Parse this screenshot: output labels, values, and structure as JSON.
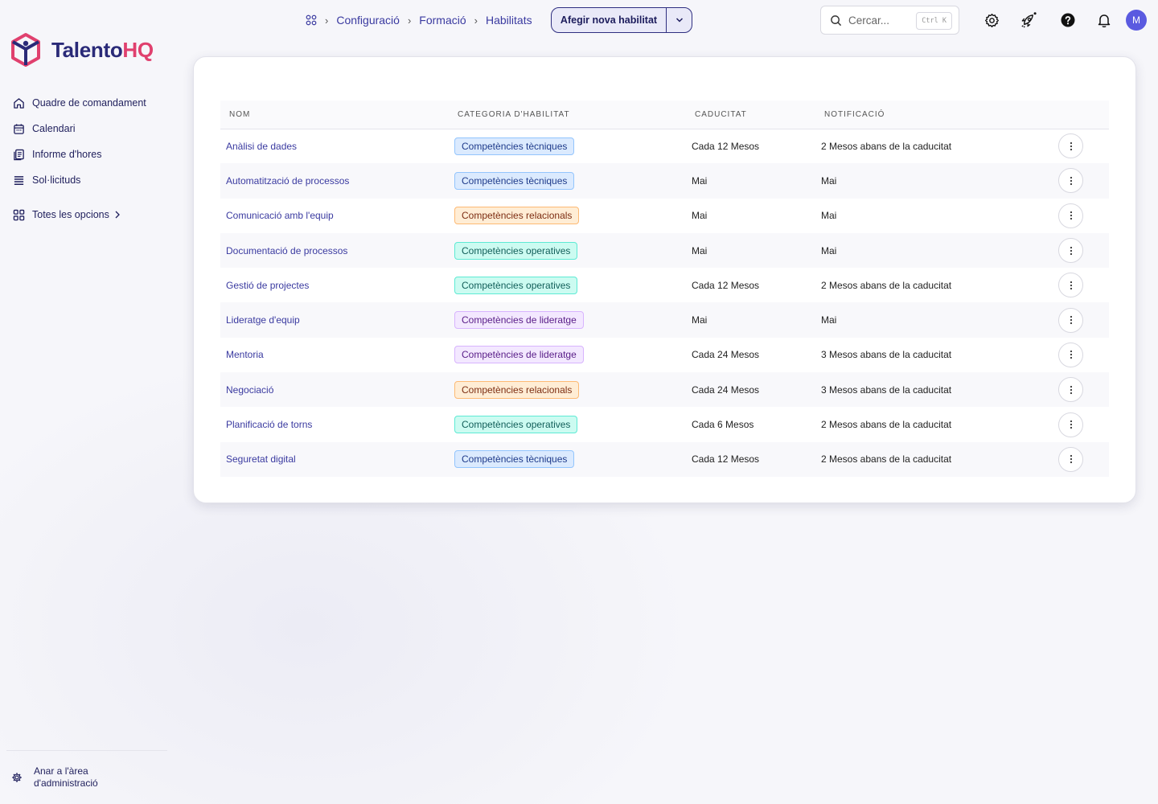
{
  "brand": {
    "name_part1": "Talento",
    "name_part2": "HQ",
    "color_primary": "#2a2a78",
    "color_accent": "#e0406e"
  },
  "sidebar": {
    "items": [
      {
        "label": "Quadre de comandament",
        "icon": "home-icon"
      },
      {
        "label": "Calendari",
        "icon": "calendar-icon"
      },
      {
        "label": "Informe d'hores",
        "icon": "report-icon"
      },
      {
        "label": "Sol·licituds",
        "icon": "list-icon"
      }
    ],
    "all_options": {
      "label": "Totes les opcions",
      "icon": "grid-icon"
    },
    "admin": {
      "line1": "Anar a l'àrea",
      "line2": "d'administració",
      "icon": "gear-icon"
    }
  },
  "topbar": {
    "breadcrumb": [
      "Configuració",
      "Formació",
      "Habilitats"
    ],
    "add_button": "Afegir nova habilitat",
    "search_placeholder": "Cercar...",
    "search_shortcut": "Ctrl K",
    "avatar_initial": "M"
  },
  "table": {
    "columns": [
      "NOM",
      "CATEGORIA D'HABILITAT",
      "CADUCITAT",
      "NOTIFICACIÓ"
    ],
    "rows": [
      {
        "name": "Anàlisi de dades",
        "category": "Competències tècniques",
        "cat": "tec",
        "expiry": "Cada 12 Mesos",
        "notice": "2 Mesos abans de la caducitat"
      },
      {
        "name": "Automatització de processos",
        "category": "Competències tècniques",
        "cat": "tec",
        "expiry": "Mai",
        "notice": "Mai"
      },
      {
        "name": "Comunicació amb l'equip",
        "category": "Competències relacionals",
        "cat": "rel",
        "expiry": "Mai",
        "notice": "Mai"
      },
      {
        "name": "Documentació de processos",
        "category": "Competències operatives",
        "cat": "ope",
        "expiry": "Mai",
        "notice": "Mai"
      },
      {
        "name": "Gestió de projectes",
        "category": "Competències operatives",
        "cat": "ope",
        "expiry": "Cada 12 Mesos",
        "notice": "2 Mesos abans de la caducitat"
      },
      {
        "name": "Lideratge d'equip",
        "category": "Competències de lideratge",
        "cat": "lid",
        "expiry": "Mai",
        "notice": "Mai"
      },
      {
        "name": "Mentoria",
        "category": "Competències de lideratge",
        "cat": "lid",
        "expiry": "Cada 24 Mesos",
        "notice": "3 Mesos abans de la caducitat"
      },
      {
        "name": "Negociació",
        "category": "Competències relacionals",
        "cat": "rel",
        "expiry": "Cada 24 Mesos",
        "notice": "3 Mesos abans de la caducitat"
      },
      {
        "name": "Planificació de torns",
        "category": "Competències operatives",
        "cat": "ope",
        "expiry": "Cada 6 Mesos",
        "notice": "2 Mesos abans de la caducitat"
      },
      {
        "name": "Seguretat digital",
        "category": "Competències tècniques",
        "cat": "tec",
        "expiry": "Cada 12 Mesos",
        "notice": "2 Mesos abans de la caducitat"
      }
    ]
  }
}
